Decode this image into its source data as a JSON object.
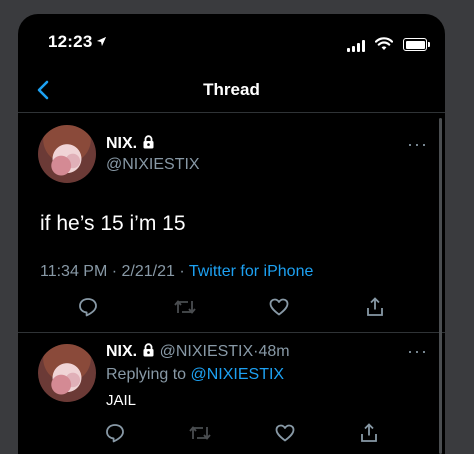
{
  "status_bar": {
    "time": "12:23"
  },
  "nav": {
    "title": "Thread"
  },
  "main_tweet": {
    "name": "NIX.",
    "handle": "@NIXIESTIX",
    "text": "if he’s 15 i’m 15",
    "time": "11:34 PM",
    "date": "2/21/21",
    "separator": "·",
    "source": "Twitter for iPhone",
    "more": "···"
  },
  "reply_tweet": {
    "name": "NIX.",
    "handle": "@NIXIESTIX",
    "age": "48m",
    "separator": "·",
    "replying_prefix": "Replying to",
    "replying_handle": "@NIXIESTIX",
    "text": "JAIL",
    "more": "···"
  },
  "colors": {
    "accent": "#1da1f2",
    "muted": "#8899a6",
    "background": "#000000",
    "divider": "#2f3336"
  },
  "icons": [
    "location-arrow-icon",
    "signal-icon",
    "wifi-icon",
    "battery-icon",
    "back-chevron-icon",
    "lock-icon",
    "reply-icon",
    "retweet-icon",
    "like-icon",
    "share-icon",
    "more-icon"
  ]
}
